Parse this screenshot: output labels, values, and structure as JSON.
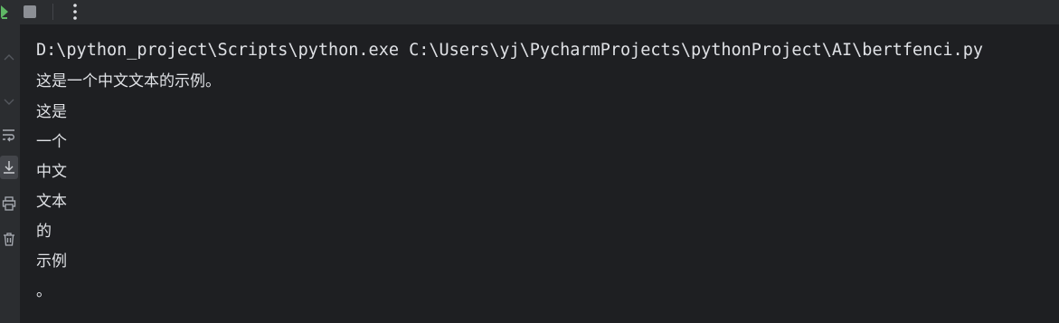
{
  "toolbar": {
    "rerun_icon": "rerun-icon",
    "stop_icon": "stop-icon",
    "more_icon": "more-options-icon"
  },
  "sidebar": {
    "icons": [
      "scroll-up-icon",
      "scroll-down-icon",
      "soft-wrap-icon",
      "scroll-to-end-icon",
      "print-icon",
      "delete-icon"
    ]
  },
  "console": {
    "command": "D:\\python_project\\Scripts\\python.exe C:\\Users\\yj\\PycharmProjects\\pythonProject\\AI\\bertfenci.py",
    "lines": [
      "这是一个中文文本的示例。",
      "这是",
      "一个",
      "中文",
      "文本",
      "的",
      "示例",
      "。"
    ]
  },
  "colors": {
    "background": "#1e1f22",
    "panel": "#2b2d30",
    "text": "#dfe1e5",
    "rerun_green": "#5fb865",
    "icon": "#a9adb4"
  }
}
